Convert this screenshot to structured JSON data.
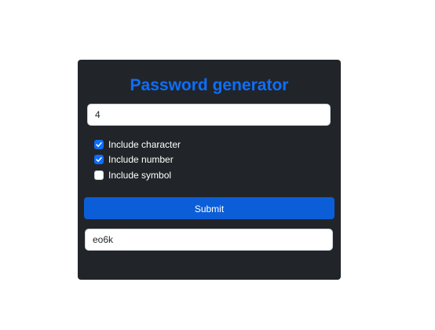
{
  "app": {
    "title": "Password generator"
  },
  "form": {
    "length_value": "4",
    "options": [
      {
        "label": "Include character",
        "checked": true
      },
      {
        "label": "Include number",
        "checked": true
      },
      {
        "label": "Include symbol",
        "checked": false
      }
    ],
    "submit_label": "Submit",
    "output_value": "eo6k"
  },
  "colors": {
    "card_bg": "#212529",
    "accent": "#0d6efd",
    "button_bg": "#0b5ed7"
  }
}
